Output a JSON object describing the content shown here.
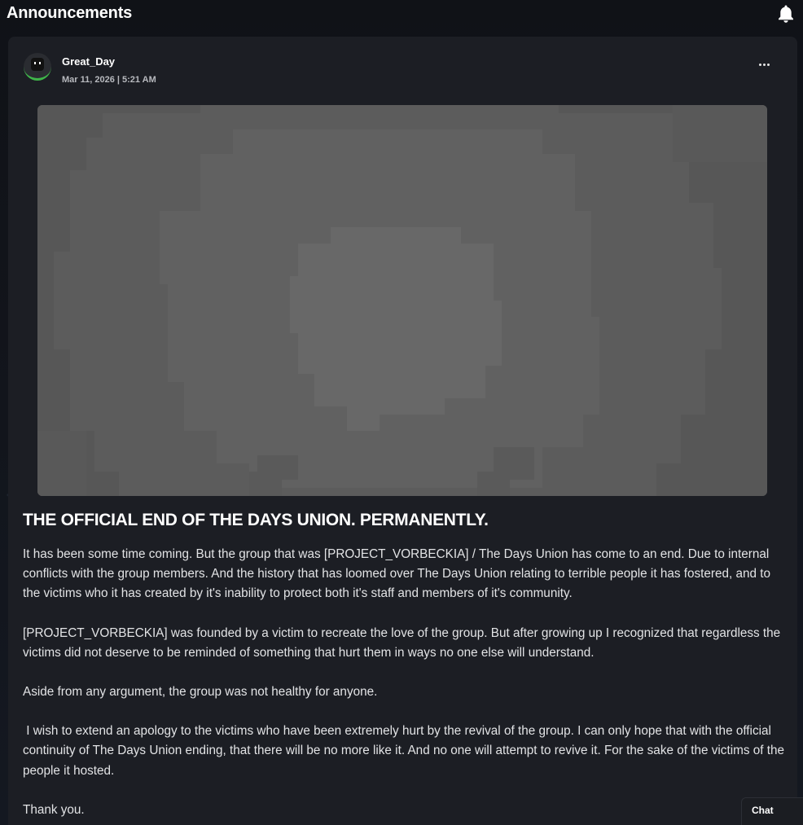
{
  "header": {
    "title": "Announcements",
    "bell_icon": "bell-icon"
  },
  "post": {
    "author": "Great_Day",
    "date": "Mar 11, 2026 | 5:21 AM",
    "menu_icon": "more-options-icon",
    "title": "THE OFFICIAL END OF THE DAYS UNION. PERMANENTLY.",
    "paragraphs": [
      "It has been some time coming. But the group that was [PROJECT_VORBECKIA] / The Days Union has come to an end. Due to internal conflicts with the group members. And the history that has loomed over The Days Union relating to terrible people it has fostered, and to the victims who it has created by it's inability to protect both it's staff and members of it's community.",
      "[PROJECT_VORBECKIA] was founded by a victim to recreate the love of the group. But after growing up I recognized that regardless the victims did not deserve to be reminded of something that hurt them in ways no one else will understand.",
      "Aside from any argument, the group was not healthy for anyone.",
      " I wish to extend an apology to the victims who have been extremely hurt by the revival of the group. I can only hope that with the official continuity of The Days Union ending, that there will be no more like it. And no one will attempt to revive it. For the sake of the victims of the people it hosted.",
      "Thank you."
    ]
  },
  "chat": {
    "label": "Chat"
  },
  "colors": {
    "accent_green": "#3fb54a",
    "card_bg": "#1c1e24",
    "page_bg": "#121419"
  }
}
